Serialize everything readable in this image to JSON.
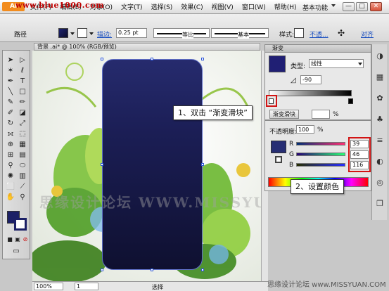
{
  "topbar": {
    "logo_text": "Ai",
    "watermark": "www.blue1000.com",
    "menus": [
      "文件(F)",
      "编辑(E)",
      "对象(O)",
      "文字(T)",
      "选择(S)",
      "效果(C)",
      "视图(V)",
      "窗口(W)",
      "帮助(H)"
    ],
    "workspace": "基本功能",
    "min_label": "—",
    "max_label": "□",
    "close_label": "✕"
  },
  "controlbar": {
    "object_type": "路径",
    "stroke_label": "描边:",
    "stroke_weight": "0.25 pt",
    "profile_label": "等比",
    "brush_label": "基本",
    "style_label": "样式:",
    "opacity_link": "不透...",
    "align_link": "对齐"
  },
  "document": {
    "tab_title": "背景 .ai* @ 100% (RGB/预览)",
    "zoom": "100%",
    "artboard_number": "1",
    "status_text": "选择",
    "canvas_watermark": "思缘设计论坛 WWW.MISSYUAN.COM MYVINET"
  },
  "gradient_panel": {
    "title": "渐变",
    "type_label": "类型:",
    "type_value": "线性",
    "angle_value": "-90",
    "location_label": "渐变滑块",
    "percent_value": "",
    "percent_sign": "%",
    "opacity_label": "不透明度:",
    "opacity_value": "100",
    "opacity_sign": "%"
  },
  "color_panel": {
    "r_label": "R",
    "g_label": "G",
    "b_label": "B",
    "r_value": "39",
    "g_value": "46",
    "b_value": "116",
    "fill_color": "#272e74"
  },
  "callouts": {
    "step1": "1、双击 “渐变滑块”",
    "step2": "2、设置颜色"
  },
  "footer": {
    "site_watermark": "思缘设计论坛  www.MISSYUAN.COM"
  },
  "colors": {
    "accent_red": "#d21414",
    "artboard_top": "#262b6e",
    "artboard_bottom": "#0f1030"
  }
}
